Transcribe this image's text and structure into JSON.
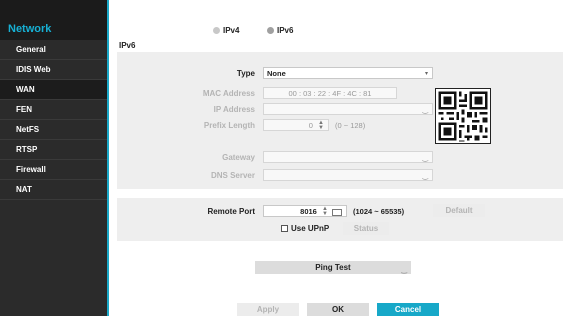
{
  "sidebar": {
    "title": "Network",
    "items": [
      {
        "label": "General",
        "active": false
      },
      {
        "label": "IDIS Web",
        "active": false
      },
      {
        "label": "WAN",
        "active": true
      },
      {
        "label": "FEN",
        "active": false
      },
      {
        "label": "NetFS",
        "active": false
      },
      {
        "label": "RTSP",
        "active": false
      },
      {
        "label": "Firewall",
        "active": false
      },
      {
        "label": "NAT",
        "active": false
      }
    ]
  },
  "protocol": {
    "ipv4": "IPv4",
    "ipv6": "IPv6",
    "selected": "IPv6"
  },
  "section_title": "IPv6",
  "form": {
    "type_label": "Type",
    "type_value": "None",
    "mac_label": "MAC Address",
    "mac_value": "00 : 03 : 22 : 4F : 4C : 81",
    "ip_label": "IP Address",
    "ip_value": "",
    "prefix_label": "Prefix Length",
    "prefix_value": "0",
    "prefix_range": "(0 ~ 128)",
    "gateway_label": "Gateway",
    "gateway_value": "",
    "dns_label": "DNS Server",
    "dns_value": ""
  },
  "port": {
    "label": "Remote Port",
    "value": "8016",
    "range": "(1024 ~ 65535)",
    "default_label": "Default",
    "upnp_label": "Use UPnP",
    "status_label": "Status"
  },
  "ping_test": "Ping Test",
  "footer": {
    "apply": "Apply",
    "ok": "OK",
    "cancel": "Cancel"
  },
  "colors": {
    "accent": "#17a8c8",
    "sidebar_bg": "#2b2b2b"
  }
}
